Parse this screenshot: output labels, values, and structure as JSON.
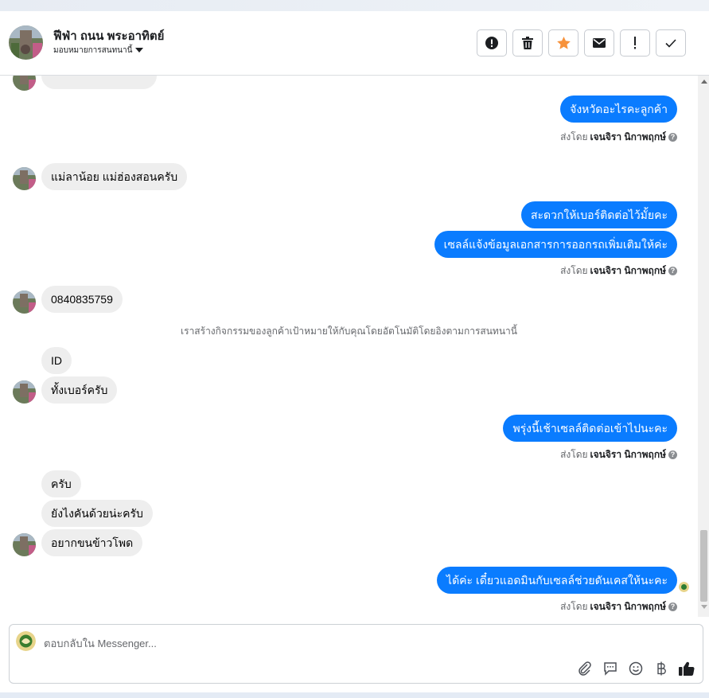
{
  "header": {
    "contact_name": "ฟีฟ่า ถนน พระอาทิตย์",
    "assign_label": "มอบหมายการสนทนานี้"
  },
  "toolbar": {
    "buttons": [
      {
        "name": "report-button",
        "icon": "alert-circle-icon"
      },
      {
        "name": "delete-button",
        "icon": "trash-icon"
      },
      {
        "name": "star-button",
        "icon": "star-icon",
        "color": "#f7923b"
      },
      {
        "name": "mark-unread-button",
        "icon": "envelope-icon"
      },
      {
        "name": "follow-up-button",
        "icon": "exclamation-icon"
      },
      {
        "name": "mark-done-button",
        "icon": "check-icon"
      }
    ]
  },
  "colors": {
    "outgoing_bubble": "#0a7cff",
    "incoming_bubble": "#eeeeee",
    "star": "#f7923b"
  },
  "messages": {
    "m1": "จังหวัดอะไรคะลูกค้า",
    "m2": "แม่ลาน้อย แม่ฮ่องสอนครับ",
    "m3": "สะดวกให้เบอร์ติดต่อไว้มั้ยคะ",
    "m4": "เซลล์แจ้งข้อมูลเอกสารการออกรถเพิ่มเติมให้ค่ะ",
    "m5": "0840835759",
    "m6": "ID",
    "m7": "ทั้งเบอร์ครับ",
    "m8": "พรุ่งนี้เช้าเซลล์ติดต่อเข้าไปนะคะ",
    "m9": "ครับ",
    "m10": "ยังไงคันด้วยน่ะครับ",
    "m11": "อยากขนข้าวโพด",
    "m12": "ได้ค่ะ เดี๋ยวแอดมินกับเซลล์ช่วยดันเคสให้นะคะ"
  },
  "sent_by": {
    "prefix": "ส่งโดย",
    "agent": "เจนจิรา นิกาพฤกษ์"
  },
  "system_note": "เราสร้างกิจกรรมของลูกค้าเป้าหมายให้กับคุณโดยอัตโนมัติโดยอิงตามการสนทนานี้",
  "composer": {
    "placeholder": "ตอบกลับใน Messenger...",
    "tools": [
      "paperclip-icon",
      "chat-template-icon",
      "emoji-icon",
      "baht-icon",
      "thumbs-up-icon"
    ]
  }
}
